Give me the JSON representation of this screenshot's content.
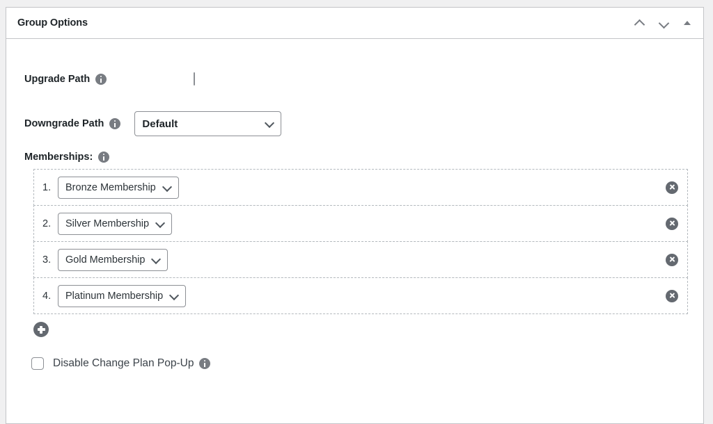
{
  "panel": {
    "title": "Group Options",
    "header_actions": [
      {
        "name": "move-up",
        "icon": "chevron-up-icon"
      },
      {
        "name": "move-down",
        "icon": "chevron-down-icon"
      },
      {
        "name": "toggle-panel",
        "icon": "triangle-up-icon"
      }
    ]
  },
  "fields": {
    "upgrade_path": {
      "label": "Upgrade Path",
      "info_icon": "info-icon",
      "checkbox_checked": false
    },
    "downgrade_path": {
      "label": "Downgrade Path",
      "info_icon": "info-icon",
      "value": "Default"
    },
    "memberships": {
      "label": "Memberships:",
      "info_icon": "info-icon",
      "rows": [
        {
          "index": "1.",
          "value": "Bronze Membership",
          "remove_icon": "remove-circle-icon"
        },
        {
          "index": "2.",
          "value": "Silver Membership",
          "remove_icon": "remove-circle-icon"
        },
        {
          "index": "3.",
          "value": "Gold Membership",
          "remove_icon": "remove-circle-icon"
        },
        {
          "index": "4.",
          "value": "Platinum Membership",
          "remove_icon": "remove-circle-icon"
        }
      ],
      "add_icon": "add-circle-icon"
    },
    "disable_popup": {
      "label": "Disable Change Plan Pop-Up",
      "info_icon": "info-icon",
      "checkbox_checked": false
    }
  },
  "colors": {
    "page_background": "#f0f0f1",
    "panel_background": "#ffffff",
    "border": "#c3c4c7",
    "text": "#1d2327",
    "icon_gray": "#787c82",
    "button_gray": "#646970",
    "dashed_border": "#b4b9be"
  }
}
